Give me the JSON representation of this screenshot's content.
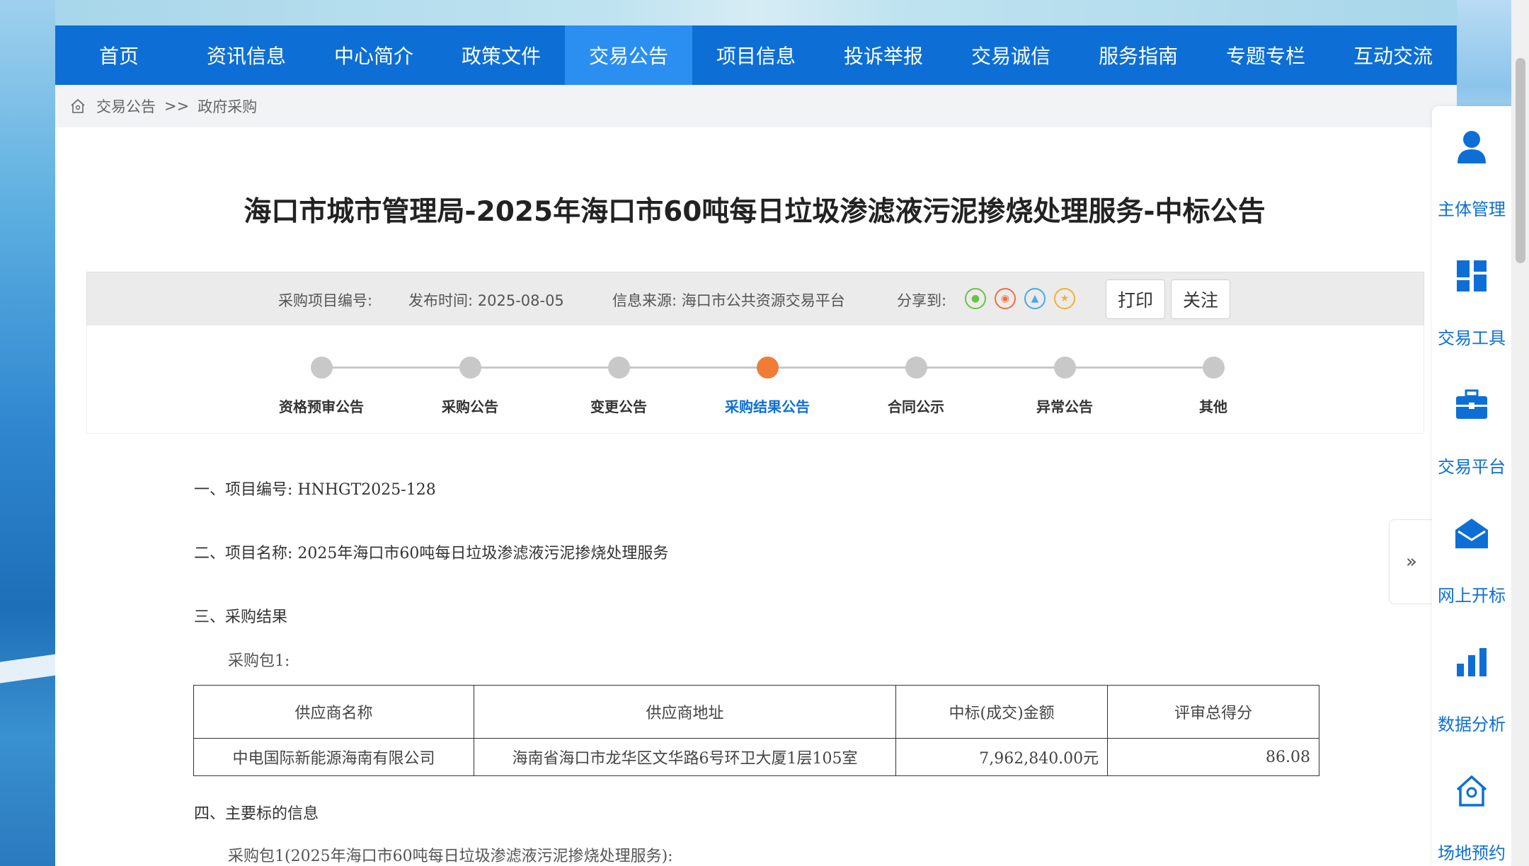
{
  "nav": {
    "items": [
      "首页",
      "资讯信息",
      "中心简介",
      "政策文件",
      "交易公告",
      "项目信息",
      "投诉举报",
      "交易诚信",
      "服务指南",
      "专题专栏",
      "互动交流"
    ],
    "active_index": 4
  },
  "breadcrumb": {
    "home": "交易公告",
    "sep": ">>",
    "current": "政府采购"
  },
  "article": {
    "title": "海口市城市管理局-2025年海口市60吨每日垃圾渗滤液污泥掺烧处理服务-中标公告"
  },
  "info": {
    "project_no_label": "采购项目编号:",
    "publish_time": "发布时间:  2025-08-05",
    "source": "信息来源:  海口市公共资源交易平台",
    "share_label": "分享到:",
    "share_icons": [
      "wechat-icon",
      "weibo-icon",
      "qq-icon",
      "qzone-icon"
    ],
    "print_label": "打印",
    "follow_label": "关注"
  },
  "steps": {
    "items": [
      "资格预审公告",
      "采购公告",
      "变更公告",
      "采购结果公告",
      "合同公示",
      "异常公告",
      "其他"
    ],
    "active_index": 3
  },
  "content": {
    "line1": "一、项目编号: HNHGT2025-128",
    "line2": "二、项目名称: 2025年海口市60吨每日垃圾渗滤液污泥掺烧处理服务",
    "line3": "三、采购结果",
    "package1": "采购包1:",
    "line4": "四、主要标的信息",
    "package1_detail": "采购包1(2025年海口市60吨每日垃圾渗滤液污泥掺烧处理服务):"
  },
  "table": {
    "headers": [
      "供应商名称",
      "供应商地址",
      "中标(成交)金额",
      "评审总得分"
    ],
    "rows": [
      [
        "中电国际新能源海南有限公司",
        "海南省海口市龙华区文华路6号环卫大厦1层105室",
        "7,962,840.00元",
        "86.08"
      ]
    ]
  },
  "sidebar": {
    "items": [
      {
        "label": "主体管理",
        "icon": "user-icon"
      },
      {
        "label": "交易工具",
        "icon": "tools-grid-icon"
      },
      {
        "label": "交易平台",
        "icon": "briefcase-icon"
      },
      {
        "label": "网上开标",
        "icon": "mail-open-icon"
      },
      {
        "label": "数据分析",
        "icon": "bar-chart-icon"
      },
      {
        "label": "场地预约",
        "icon": "home-location-icon"
      }
    ],
    "collapse_icon": "double-chevron-right-icon"
  },
  "colors": {
    "brand": "#0d6fd6",
    "nav_active": "#2a8ff0",
    "step_active": "#f07c35"
  }
}
